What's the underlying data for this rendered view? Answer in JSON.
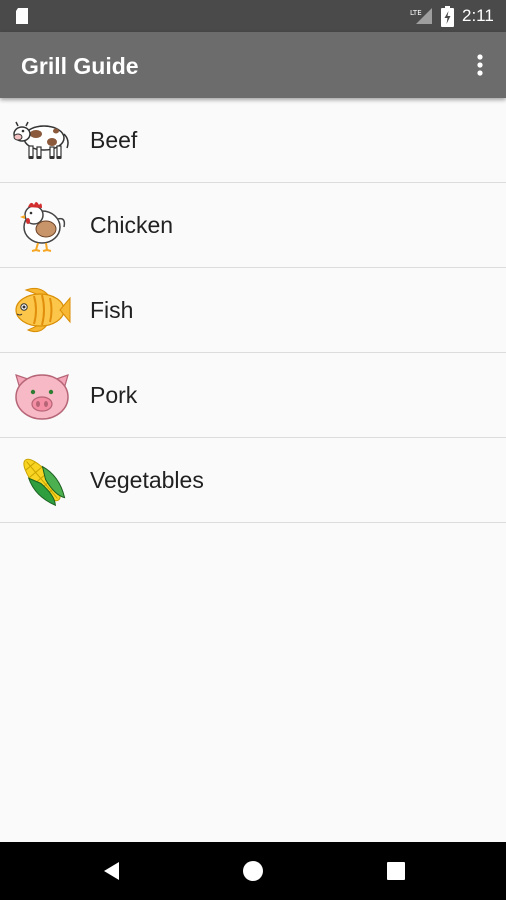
{
  "status_bar": {
    "time": "2:11",
    "network": "LTE"
  },
  "app_bar": {
    "title": "Grill Guide",
    "menu_icon": "more-vert-icon"
  },
  "categories": [
    {
      "label": "Beef",
      "icon": "cow-icon"
    },
    {
      "label": "Chicken",
      "icon": "chicken-icon"
    },
    {
      "label": "Fish",
      "icon": "fish-icon"
    },
    {
      "label": "Pork",
      "icon": "pig-icon"
    },
    {
      "label": "Vegetables",
      "icon": "corn-icon"
    }
  ],
  "nav_bar": {
    "back_icon": "back-icon",
    "home_icon": "home-icon",
    "recents_icon": "recents-icon"
  },
  "colors": {
    "status_bar": "#4a4a4a",
    "app_bar": "#6c6c6c",
    "background": "#fafafa",
    "divider": "#dcdcdc"
  }
}
